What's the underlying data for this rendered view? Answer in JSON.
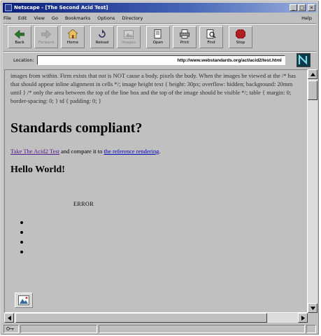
{
  "window": {
    "title": "Netscape - [The Second Acid Test]",
    "buttons": {
      "minimize": "_",
      "maximize": "□",
      "close": "×"
    }
  },
  "menu": [
    "File",
    "Edit",
    "View",
    "Go",
    "Bookmarks",
    "Options",
    "Directory"
  ],
  "menu_help": "Help",
  "toolbar": [
    {
      "label": "Back",
      "icon": "back-arrow-icon",
      "enabled": true
    },
    {
      "label": "Forward",
      "icon": "forward-arrow-icon",
      "enabled": false
    },
    {
      "label": "Home",
      "icon": "home-icon",
      "enabled": true
    },
    {
      "label": "Reload",
      "icon": "reload-icon",
      "enabled": true
    },
    {
      "label": "Images",
      "icon": "images-icon",
      "enabled": false
    },
    {
      "label": "Open",
      "icon": "open-icon",
      "enabled": true
    },
    {
      "label": "Print",
      "icon": "print-icon",
      "enabled": true
    },
    {
      "label": "Find",
      "icon": "find-icon",
      "enabled": true
    },
    {
      "label": "Stop",
      "icon": "stop-icon",
      "enabled": true
    }
  ],
  "location": {
    "label": "Location:",
    "url": "http://www.webstandards.org/act/acid2/test.html"
  },
  "content": {
    "intro": "images from within. Firm exists that not is NOT cause a body. pixels the body. When the images be viewed at the /* has that should appear inline alignment in cells */; image height text { height: 30px; overflow: hidden; background: 20mm until } /* only the area between the top of the line box and the top of the image should be visible */; table { margin: 0; border-spacing: 0; } td { padding: 0; }",
    "heading": "Standards compliant?",
    "link1": "Take The Acid2 Test",
    "link_middle": " and compare it to ",
    "link2": "the reference rendering",
    "link_end": ".",
    "hello": "Hello World!",
    "error": "ERROR",
    "bullet_count": 4
  },
  "status": {
    "security": "",
    "text": ""
  }
}
